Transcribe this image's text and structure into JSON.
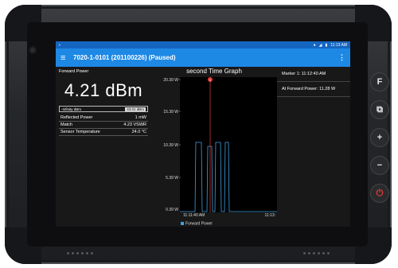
{
  "statusbar": {
    "left_icon": "sim-card-icon",
    "time": "11:13 AM"
  },
  "appbar": {
    "title": "7020-1-0101 (201100226) (Paused)"
  },
  "left": {
    "label": "Forward Power",
    "value": "4.21 dBm",
    "range_min": "-Infinity dBm",
    "range_max": "43.01 dBm",
    "metrics": [
      {
        "name": "Reflected Power",
        "value": "1 mW"
      },
      {
        "name": "Match",
        "value": "4.23 VSWR"
      },
      {
        "name": "Sensor Temperature",
        "value": "24.0 °C"
      }
    ]
  },
  "graph": {
    "title": "second Time Graph",
    "y_ticks": [
      "20.39 W",
      "15.39 W",
      "10.39 W",
      "5.39 W",
      "0.39 W"
    ],
    "x_start": "11:11:40 AM",
    "x_end": "11:13:",
    "marker_label": "1",
    "legend": "Forward Power"
  },
  "right": {
    "marker": "Marker 1: 11:12:40 AM",
    "at_power": "At Forward Power: 11.28 W"
  },
  "side_buttons": [
    "F",
    "⧉",
    "+",
    "−",
    "⏻"
  ]
}
